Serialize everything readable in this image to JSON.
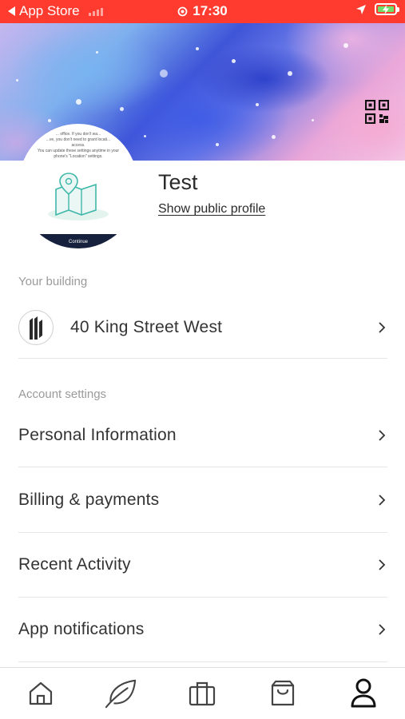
{
  "status_bar": {
    "back_app": "App Store",
    "time": "17:30"
  },
  "avatar": {
    "line1": "... office. If you don't wa...",
    "line2": "...ve, you don't need to grant locati...",
    "line3": "access.",
    "line4": "You can update these settings anytime in your",
    "line5": "phone's \"Location\" settings.",
    "continue": "Continue"
  },
  "profile": {
    "name": "Test",
    "public_profile_link": "Show public profile"
  },
  "building_section": {
    "label": "Your building",
    "building_name": "40 King Street West"
  },
  "account_section": {
    "label": "Account settings",
    "items": [
      {
        "label": "Personal Information"
      },
      {
        "label": "Billing & payments"
      },
      {
        "label": "Recent Activity"
      },
      {
        "label": "App notifications"
      }
    ]
  },
  "tabbar": {
    "tabs": [
      {
        "icon": "home-icon"
      },
      {
        "icon": "leaf-icon"
      },
      {
        "icon": "briefcase-icon"
      },
      {
        "icon": "shopping-bag-icon"
      },
      {
        "icon": "person-icon",
        "active": true
      }
    ]
  }
}
